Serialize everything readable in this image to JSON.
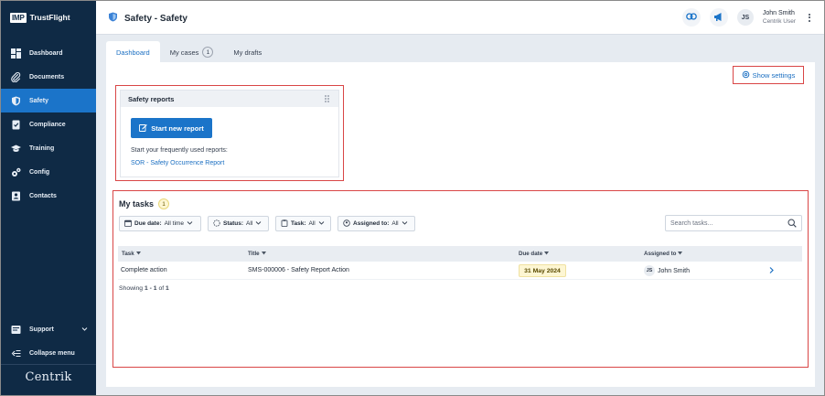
{
  "sidebar": {
    "brand_badge": "IMP",
    "brand_name": "TrustFlight",
    "items": [
      {
        "label": "Dashboard",
        "icon": "dashboard-icon"
      },
      {
        "label": "Documents",
        "icon": "paperclip-icon"
      },
      {
        "label": "Safety",
        "icon": "shield-icon",
        "active": true
      },
      {
        "label": "Compliance",
        "icon": "compliance-icon"
      },
      {
        "label": "Training",
        "icon": "graduation-cap-icon"
      },
      {
        "label": "Config",
        "icon": "gears-icon"
      },
      {
        "label": "Contacts",
        "icon": "contacts-icon"
      }
    ],
    "support_label": "Support",
    "collapse_label": "Collapse menu",
    "footer_logo": "Centrik"
  },
  "header": {
    "title": "Safety - Safety",
    "user_initials": "JS",
    "user_name": "John Smith",
    "user_role": "Centrik User"
  },
  "tabs": [
    {
      "label": "Dashboard",
      "active": true
    },
    {
      "label": "My cases",
      "count": "1"
    },
    {
      "label": "My drafts"
    }
  ],
  "settings_link": "Show settings",
  "safety_reports": {
    "title": "Safety reports",
    "start_button": "Start new report",
    "frequent_text": "Start your frequently used reports:",
    "frequent_link": "SOR - Safety Occurrence Report"
  },
  "tasks": {
    "title": "My tasks",
    "count": "1",
    "filters": [
      {
        "label": "Due date:",
        "value": "All time"
      },
      {
        "label": "Status:",
        "value": "All"
      },
      {
        "label": "Task:",
        "value": "All"
      },
      {
        "label": "Assigned to:",
        "value": "All"
      }
    ],
    "search_placeholder": "Search tasks...",
    "columns": [
      "Task",
      "Title",
      "Due date",
      "Assigned to"
    ],
    "rows": [
      {
        "task": "Complete action",
        "title": "SMS-000006 - Safety Report Action",
        "due": "31 May 2024",
        "assignee_initials": "JS",
        "assignee": "John Smith"
      }
    ],
    "showing_prefix": "Showing",
    "showing_range": "1 - 1",
    "showing_of": "of",
    "showing_total": "1"
  },
  "colors": {
    "sidebar_bg": "#0f2a45",
    "accent": "#1b74c9",
    "highlight": "#d94646",
    "due_badge_bg": "#fdf6d3"
  }
}
